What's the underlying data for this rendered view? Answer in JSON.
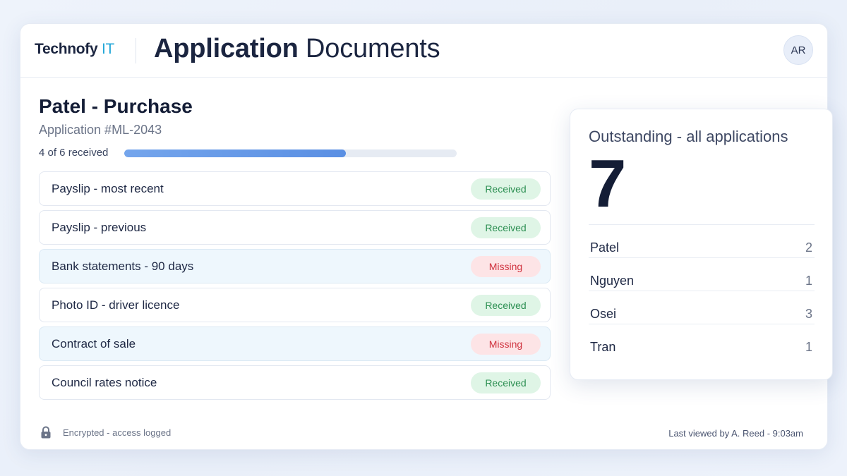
{
  "header": {
    "brand_main": "Technofy",
    "brand_accent": "IT",
    "title_strong": "Application",
    "title_rest": "Documents",
    "avatar_initials": "AR"
  },
  "application": {
    "name": "Patel - Purchase",
    "number": "Application #ML-2043",
    "progress_label": "4 of 6 received",
    "received": 4,
    "total": 6,
    "documents": [
      {
        "name": "Payslip - most recent",
        "status": "Received"
      },
      {
        "name": "Payslip - previous",
        "status": "Received"
      },
      {
        "name": "Bank statements - 90 days",
        "status": "Missing"
      },
      {
        "name": "Photo ID - driver licence",
        "status": "Received"
      },
      {
        "name": "Contract of sale",
        "status": "Missing"
      },
      {
        "name": "Council rates notice",
        "status": "Received"
      }
    ]
  },
  "outstanding": {
    "title": "Outstanding - all applications",
    "total": "7",
    "rows": [
      {
        "name": "Patel",
        "count": "2"
      },
      {
        "name": "Nguyen",
        "count": "1"
      },
      {
        "name": "Osei",
        "count": "3"
      },
      {
        "name": "Tran",
        "count": "1"
      }
    ]
  },
  "footer": {
    "security_text": "Encrypted - access logged",
    "last_viewed": "Last viewed by A. Reed - 9:03am",
    "icon": "lock-icon"
  },
  "colors": {
    "accent": "#23a7d8",
    "progress": "#5a8fe3",
    "received_text": "#2c8f52",
    "missing_text": "#d0333f"
  }
}
